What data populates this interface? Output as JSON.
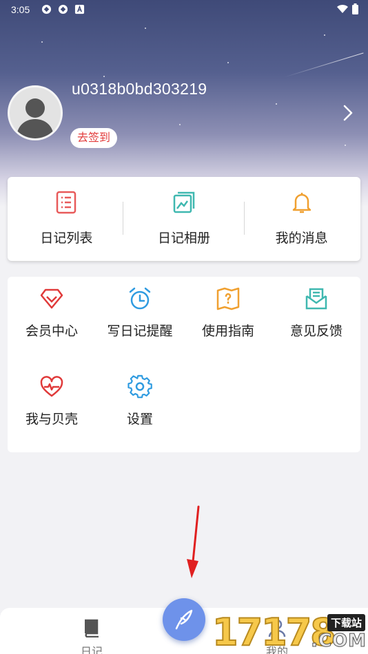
{
  "status_bar": {
    "time": "3:05"
  },
  "profile": {
    "username": "u0318b0bd303219",
    "signin_label": "去签到"
  },
  "quick_menu": [
    {
      "label": "日记列表",
      "icon": "list-icon",
      "color": "#e85a5a"
    },
    {
      "label": "日记相册",
      "icon": "album-icon",
      "color": "#3fb8b0"
    },
    {
      "label": "我的消息",
      "icon": "bell-icon",
      "color": "#f0a030"
    }
  ],
  "grid_menu": [
    {
      "label": "会员中心",
      "icon": "diamond-icon",
      "color": "#e03a3a"
    },
    {
      "label": "写日记提醒",
      "icon": "alarm-clock-icon",
      "color": "#2f9be0"
    },
    {
      "label": "使用指南",
      "icon": "guide-map-icon",
      "color": "#f0a030"
    },
    {
      "label": "意见反馈",
      "icon": "feedback-mail-icon",
      "color": "#3fb8b0"
    },
    {
      "label": "我与贝壳",
      "icon": "heart-pulse-icon",
      "color": "#e03a3a"
    },
    {
      "label": "设置",
      "icon": "gear-icon",
      "color": "#2f9be0"
    }
  ],
  "tab_bar": {
    "tabs": [
      {
        "label": "日记",
        "icon": "book-icon"
      },
      {
        "label": "我的",
        "icon": "user-icon"
      }
    ]
  },
  "watermark": {
    "number": "17178",
    "tag": "下载站",
    "suffix": ".COM"
  }
}
